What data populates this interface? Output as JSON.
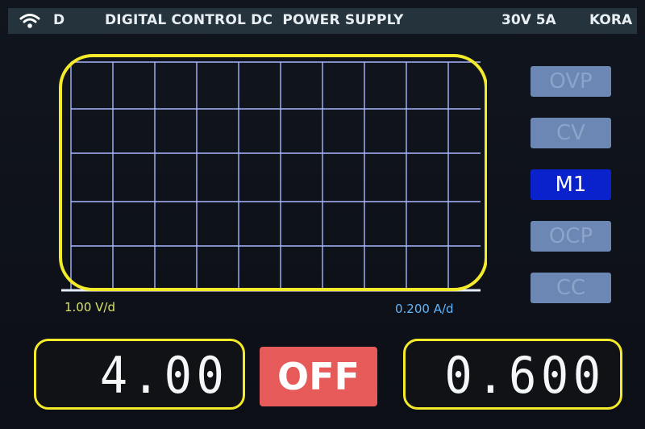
{
  "status_bar": {
    "wifi_icon": "wifi-icon",
    "mode_letter": "D",
    "title": "DIGITAL CONTROL DC  POWER SUPPLY",
    "rating": "30V 5A",
    "brand": "KORA"
  },
  "graph": {
    "voltage_scale": "1.00 V/d",
    "current_scale": "0.200 A/d",
    "highlight_color": "#f3ea2a",
    "grid_color": "#aab6ff",
    "voltage_label_color": "#d8e26a",
    "current_label_color": "#5fb6ff"
  },
  "side_buttons": [
    {
      "label": "OVP",
      "active": false
    },
    {
      "label": "CV",
      "active": false
    },
    {
      "label": "M1",
      "active": true
    },
    {
      "label": "OCP",
      "active": false
    },
    {
      "label": "CC",
      "active": false
    }
  ],
  "readouts": {
    "voltage": "4.00",
    "current": "0.600",
    "output_button": "OFF",
    "output_button_color": "#e65a5a"
  }
}
